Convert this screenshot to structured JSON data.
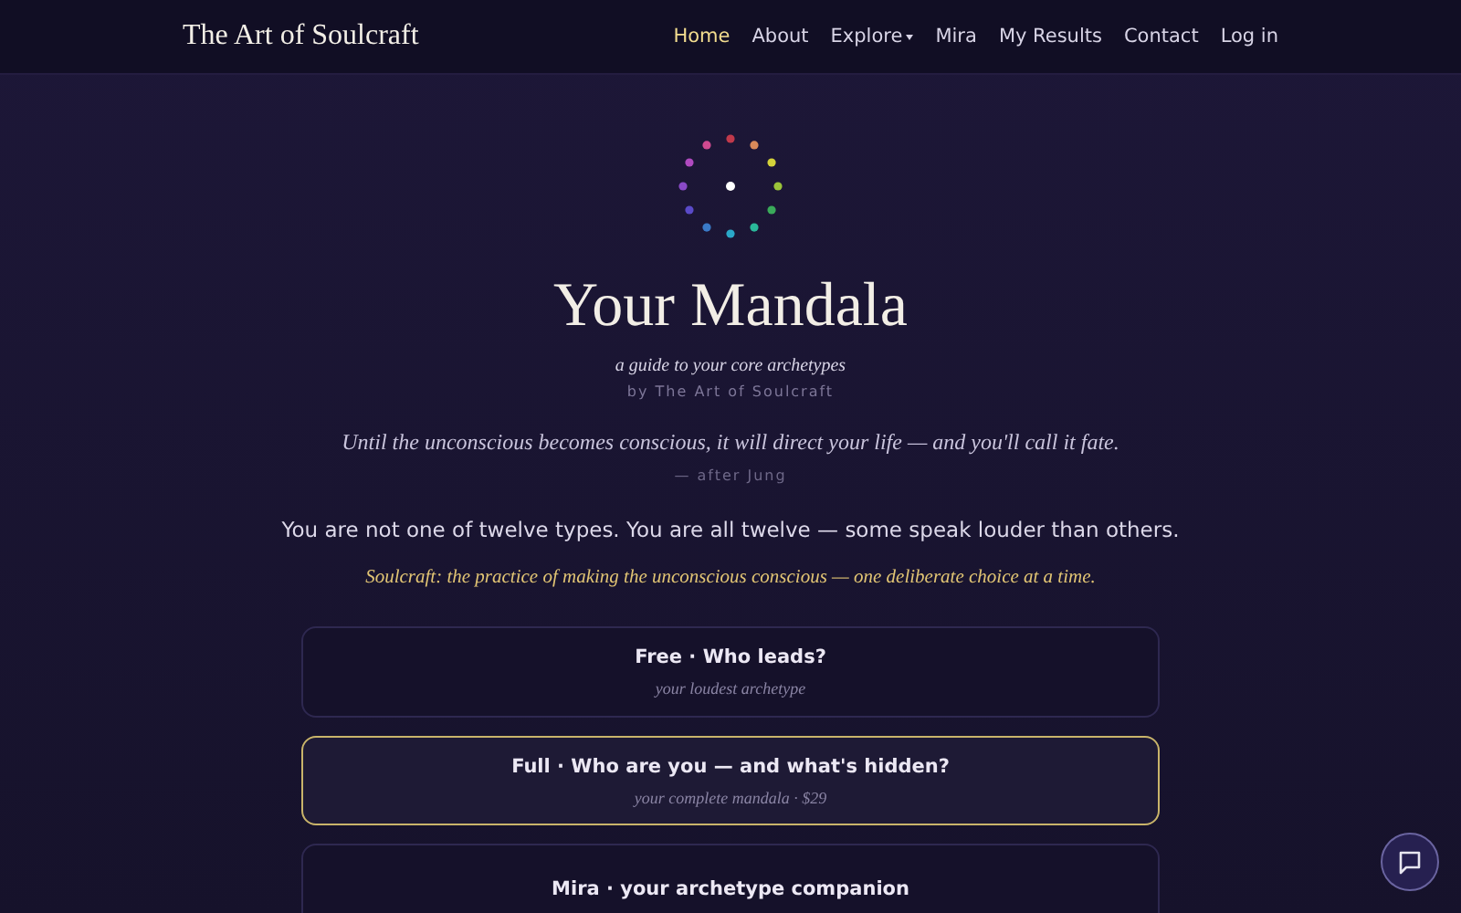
{
  "brand": "The Art of Soulcraft",
  "nav": [
    {
      "label": "Home",
      "selected": true,
      "dropdown": false
    },
    {
      "label": "About",
      "selected": false,
      "dropdown": false
    },
    {
      "label": "Explore",
      "selected": false,
      "dropdown": true
    },
    {
      "label": "Mira",
      "selected": false,
      "dropdown": false
    },
    {
      "label": "My Results",
      "selected": false,
      "dropdown": false
    },
    {
      "label": "Contact",
      "selected": false,
      "dropdown": false
    },
    {
      "label": "Log in",
      "selected": false,
      "dropdown": false
    }
  ],
  "mandala_dots": [
    {
      "color": "#c0394b"
    },
    {
      "color": "#d98a5a"
    },
    {
      "color": "#d4d23a"
    },
    {
      "color": "#9bc43a"
    },
    {
      "color": "#3aaa5a"
    },
    {
      "color": "#2ab89a"
    },
    {
      "color": "#2aa8c8"
    },
    {
      "color": "#3a7ac8"
    },
    {
      "color": "#5a4ac8"
    },
    {
      "color": "#8a4ac8"
    },
    {
      "color": "#b04ac0"
    },
    {
      "color": "#d04a90"
    }
  ],
  "title": "Your Mandala",
  "subtitle": "a guide to your core archetypes",
  "byline": "by The Art of Soulcraft",
  "quote": "Until the unconscious becomes conscious, it will direct your life — and you'll call it fate.",
  "quote_attribution": "— after Jung",
  "lead": "You are not one of twelve types. You are all twelve — some speak louder than others.",
  "definition": "Soulcraft: the practice of making the unconscious conscious — one deliberate choice at a time.",
  "options": [
    {
      "title": "Free · Who leads?",
      "subtitle": "your loudest archetype",
      "selected": false
    },
    {
      "title": "Full · Who are you — and what's hidden?",
      "subtitle": "your complete mandala · $29",
      "selected": true
    },
    {
      "title": "Mira · your archetype companion",
      "selected": false
    }
  ]
}
